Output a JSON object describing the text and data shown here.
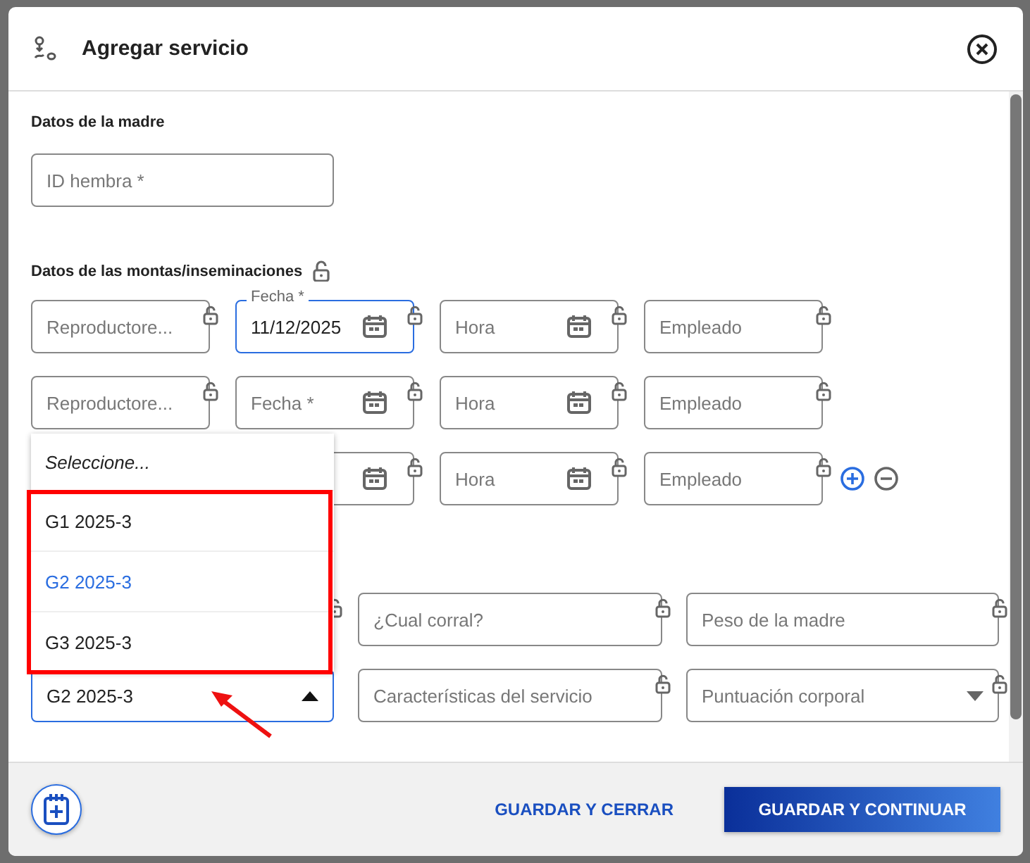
{
  "dialog": {
    "title": "Agregar servicio"
  },
  "mother_section": {
    "title": "Datos de la madre",
    "field": {
      "placeholder": "ID hembra *"
    }
  },
  "matings_section": {
    "title": "Datos de las montas/inseminaciones",
    "rows": [
      {
        "fields": [
          {
            "kind": "text",
            "placeholder": "Reproductore...",
            "focused": false
          },
          {
            "kind": "date",
            "label": "Fecha *",
            "value": "11/12/2025",
            "focused": true
          },
          {
            "kind": "date",
            "placeholder": "Hora",
            "focused": false
          },
          {
            "kind": "text",
            "placeholder": "Empleado",
            "focused": false
          }
        ]
      },
      {
        "fields": [
          {
            "kind": "text",
            "placeholder": "Reproductore...",
            "focused": false
          },
          {
            "kind": "date",
            "placeholder": "Fecha *",
            "focused": false
          },
          {
            "kind": "date",
            "placeholder": "Hora",
            "focused": false
          },
          {
            "kind": "text",
            "placeholder": "Empleado",
            "focused": false
          }
        ]
      },
      {
        "fields": [
          {
            "kind": "hidden"
          },
          {
            "kind": "date",
            "focused": false
          },
          {
            "kind": "date",
            "placeholder": "Hora",
            "focused": false
          },
          {
            "kind": "text",
            "placeholder": "Empleado",
            "focused": false
          }
        ]
      }
    ]
  },
  "details": {
    "fields": [
      {
        "kind": "hidden"
      },
      {
        "kind": "text",
        "placeholder": "¿Cual corral?",
        "focused": false
      },
      {
        "kind": "text",
        "placeholder": "Peso de la madre",
        "focused": false
      },
      {
        "kind": "select",
        "value": "G2 2025-3",
        "open": true,
        "focused": true
      },
      {
        "kind": "text",
        "placeholder": "Características del servicio",
        "focused": false
      },
      {
        "kind": "select",
        "placeholder": "Puntuación corporal",
        "open": false,
        "focused": false
      }
    ]
  },
  "dropdown": {
    "options": [
      {
        "kind": "prompt",
        "label": "Seleccione...",
        "selected": false
      },
      {
        "kind": "option",
        "label": "G1 2025-3",
        "selected": false
      },
      {
        "kind": "option",
        "label": "G2 2025-3",
        "selected": true
      },
      {
        "kind": "option",
        "label": "G3 2025-3",
        "selected": false
      }
    ]
  },
  "footer": {
    "secondary": "GUARDAR Y CERRAR",
    "primary": "GUARDAR Y CONTINUAR"
  }
}
